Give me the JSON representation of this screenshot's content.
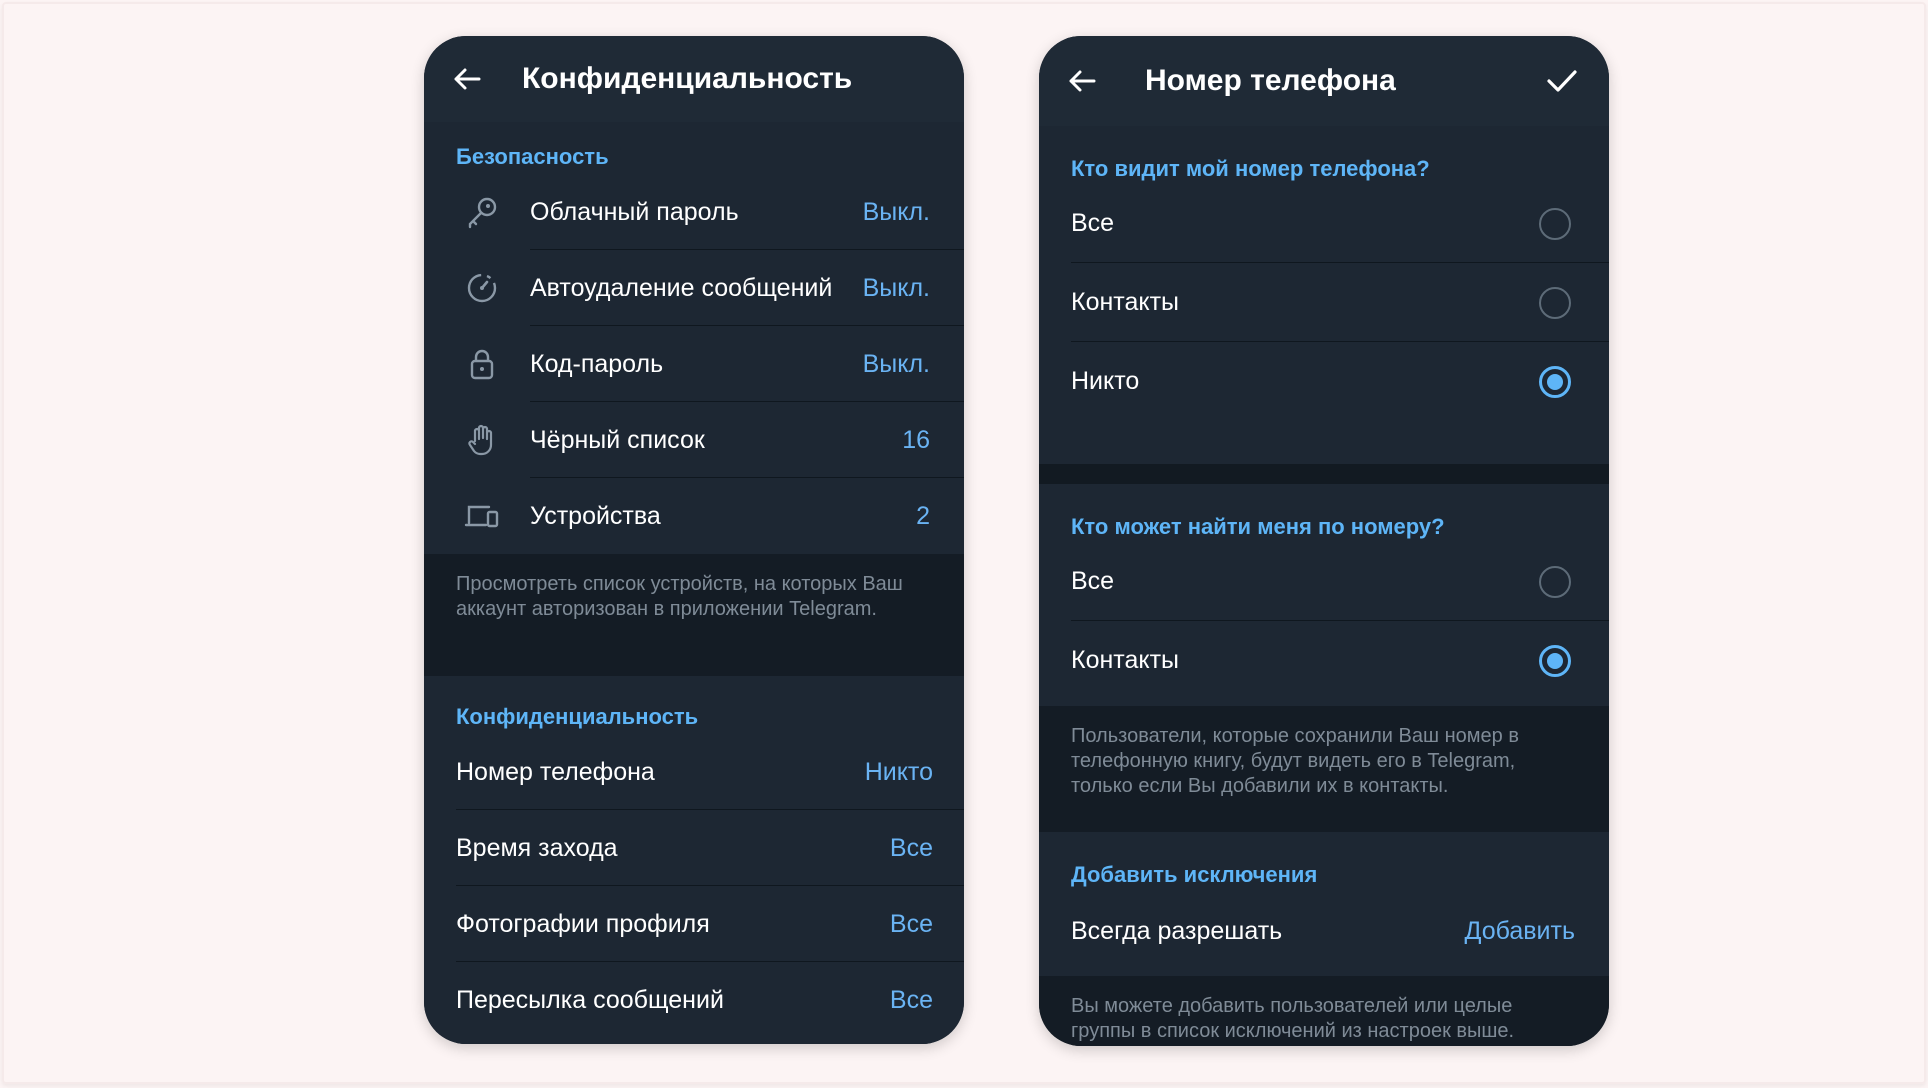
{
  "left": {
    "title": "Конфиденциальность",
    "security": {
      "header": "Безопасность",
      "items": [
        {
          "label": "Облачный пароль",
          "value": "Выкл.",
          "icon": "key-icon"
        },
        {
          "label": "Автоудаление сообщений",
          "value": "Выкл.",
          "icon": "timer-icon"
        },
        {
          "label": "Код-пароль",
          "value": "Выкл.",
          "icon": "lock-icon"
        },
        {
          "label": "Чёрный список",
          "value": "16",
          "icon": "hand-icon"
        },
        {
          "label": "Устройства",
          "value": "2",
          "icon": "devices-icon"
        }
      ],
      "hint": "Просмотреть список устройств, на которых Ваш аккаунт авторизован в приложении Telegram."
    },
    "privacy": {
      "header": "Конфиденциальность",
      "items": [
        {
          "label": "Номер телефона",
          "value": "Никто"
        },
        {
          "label": "Время захода",
          "value": "Все"
        },
        {
          "label": "Фотографии профиля",
          "value": "Все"
        },
        {
          "label": "Пересылка сообщений",
          "value": "Все"
        }
      ]
    }
  },
  "right": {
    "title": "Номер телефона",
    "who_sees": {
      "header": "Кто видит мой номер телефона?",
      "options": [
        {
          "label": "Все",
          "selected": false
        },
        {
          "label": "Контакты",
          "selected": false
        },
        {
          "label": "Никто",
          "selected": true
        }
      ]
    },
    "who_finds": {
      "header": "Кто может найти меня по номеру?",
      "options": [
        {
          "label": "Все",
          "selected": false
        },
        {
          "label": "Контакты",
          "selected": true
        }
      ],
      "hint": "Пользователи, которые сохранили Ваш номер в телефонную книгу, будут видеть его в Telegram, только если Вы добавили их в контакты."
    },
    "exceptions": {
      "header": "Добавить исключения",
      "always_allow_label": "Всегда разрешать",
      "add_label": "Добавить",
      "hint": "Вы можете добавить пользователей или целые группы в список исключений из настроек выше."
    }
  },
  "colors": {
    "accent": "#5eb5f7",
    "background": "#17212b",
    "page": "#fcf4f4"
  }
}
